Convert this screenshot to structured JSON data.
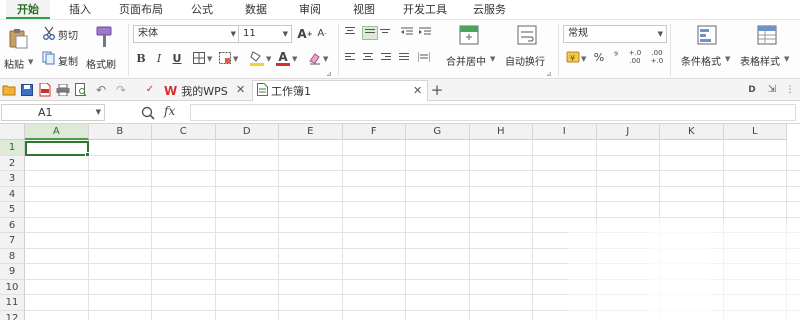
{
  "menu": {
    "tabs": [
      "开始",
      "插入",
      "页面布局",
      "公式",
      "数据",
      "审阅",
      "视图",
      "开发工具",
      "云服务"
    ]
  },
  "ribbon": {
    "clipboard": {
      "paste": "粘贴",
      "cut": "剪切",
      "copy": "复制",
      "format_painter": "格式刷"
    },
    "font": {
      "name": "宋体",
      "size": "11",
      "grow": "A",
      "shrink": "A",
      "bold": "B",
      "italic": "I",
      "underline": "U",
      "font_color_letter": "A"
    },
    "align": {
      "merge_center": "合并居中",
      "wrap_text": "自动换行"
    },
    "number": {
      "format": "常规",
      "percent": "%",
      "thousands": "⁹",
      "inc_decimal": "+.0\n.00",
      "dec_decimal": ".00\n+.0"
    },
    "styles": {
      "conditional_format": "条件格式",
      "table_style": "表格样式"
    }
  },
  "docbar": {
    "tabs": [
      {
        "label": "我的WPS",
        "active": false
      },
      {
        "label": "工作簿1",
        "active": true
      }
    ]
  },
  "formula_bar": {
    "cell_ref": "A1",
    "fx": "fx",
    "content": ""
  },
  "sheet": {
    "columns": [
      "A",
      "B",
      "C",
      "D",
      "E",
      "F",
      "G",
      "H",
      "I",
      "J",
      "K",
      "L"
    ],
    "rows": [
      "1",
      "2",
      "3",
      "4",
      "5",
      "6",
      "7",
      "8",
      "9",
      "10",
      "11",
      "12"
    ],
    "active_cell": "A1"
  },
  "colors": {
    "accent": "#2ea24b",
    "selection": "#2a7a2a",
    "header_bg": "#f2f2f2",
    "wps_red": "#d0342c"
  }
}
